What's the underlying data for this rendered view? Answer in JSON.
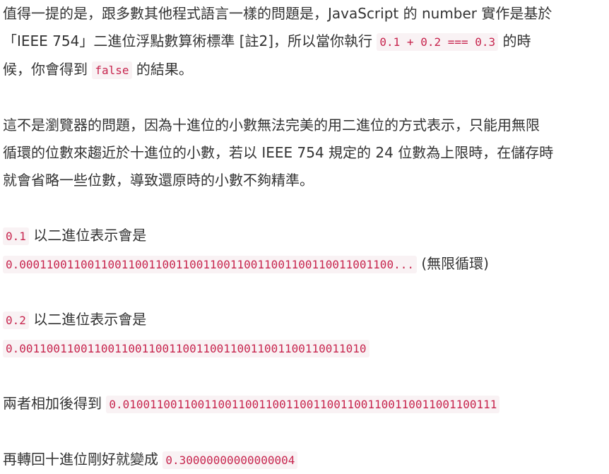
{
  "paragraph1": {
    "line1": "值得一提的是，跟多數其他程式語言一樣的問題是，JavaScript 的 number 實作是基於",
    "line2_text": "「IEEE 754」二進位浮點數算術標準 [註2]，所以當你執行 ",
    "line2_code": "0.1 + 0.2 === 0.3",
    "line2_tail": " 的時",
    "line3_text": "候，你會得到 ",
    "line3_code": "false",
    "line3_tail": " 的結果。"
  },
  "paragraph2": {
    "line1": "這不是瀏覽器的問題，因為十進位的小數無法完美的用二進位的方式表示，只能用無限",
    "line2": "循環的位數來趨近於十進位的小數，若以 IEEE 754 規定的 24 位數為上限時，在儲存時",
    "line3": "就會省略一些位數，導致還原時的小數不夠精準。"
  },
  "binary_01": {
    "code": "0.1",
    "label": " 以二進位表示會是",
    "value": "0.0001100110011001100110011001100110011001100110011001100...",
    "note": " (無限循環)"
  },
  "binary_02": {
    "code": "0.2",
    "label": " 以二進位表示會是",
    "value": "0.001100110011001100110011001100110011001100110011010"
  },
  "sum": {
    "label": "兩者相加後得到 ",
    "value": "0.0100110011001100110011001100110011001100110011001100111"
  },
  "back": {
    "label": "再轉回十進位剛好就變成 ",
    "value": "0.30000000000000004"
  }
}
